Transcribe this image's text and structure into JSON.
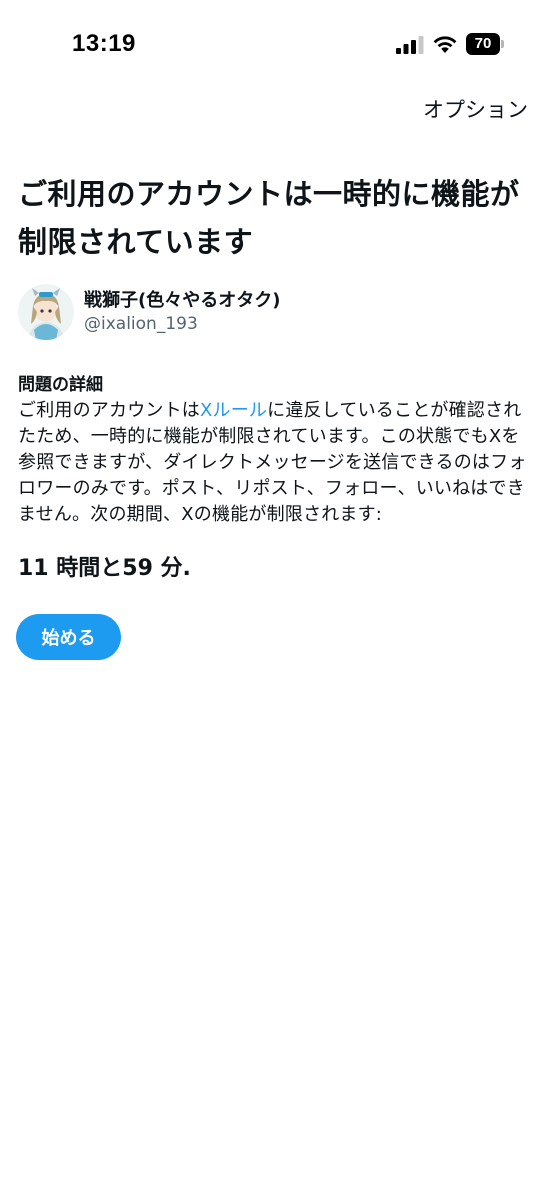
{
  "status_bar": {
    "time": "13:19",
    "battery_level": "70",
    "signal_icon": "cellular-signal-icon",
    "wifi_icon": "wifi-icon"
  },
  "header": {
    "options_label": "オプション"
  },
  "title": "ご利用のアカウントは一時的に機能が制限されています",
  "account": {
    "display_name": "戦獅子(色々やるオタク)",
    "handle": "@ixalion_193"
  },
  "details": {
    "heading": "問題の詳細",
    "text_before_link": "ご利用のアカウントは",
    "link_text": "Xルール",
    "text_after_link": "に違反していることが確認されたため、一時的に機能が制限されています。この状態でもXを参照できますが、ダイレクトメッセージを送信できるのはフォロワーのみです。ポスト、リポスト、フォロー、いいねはできません。次の期間、Xの機能が制限されます:"
  },
  "countdown": "11 時間と59 分.",
  "start_button_label": "始める",
  "colors": {
    "accent": "#1d9bf0",
    "text": "#0f1419",
    "secondary_text": "#536471"
  }
}
